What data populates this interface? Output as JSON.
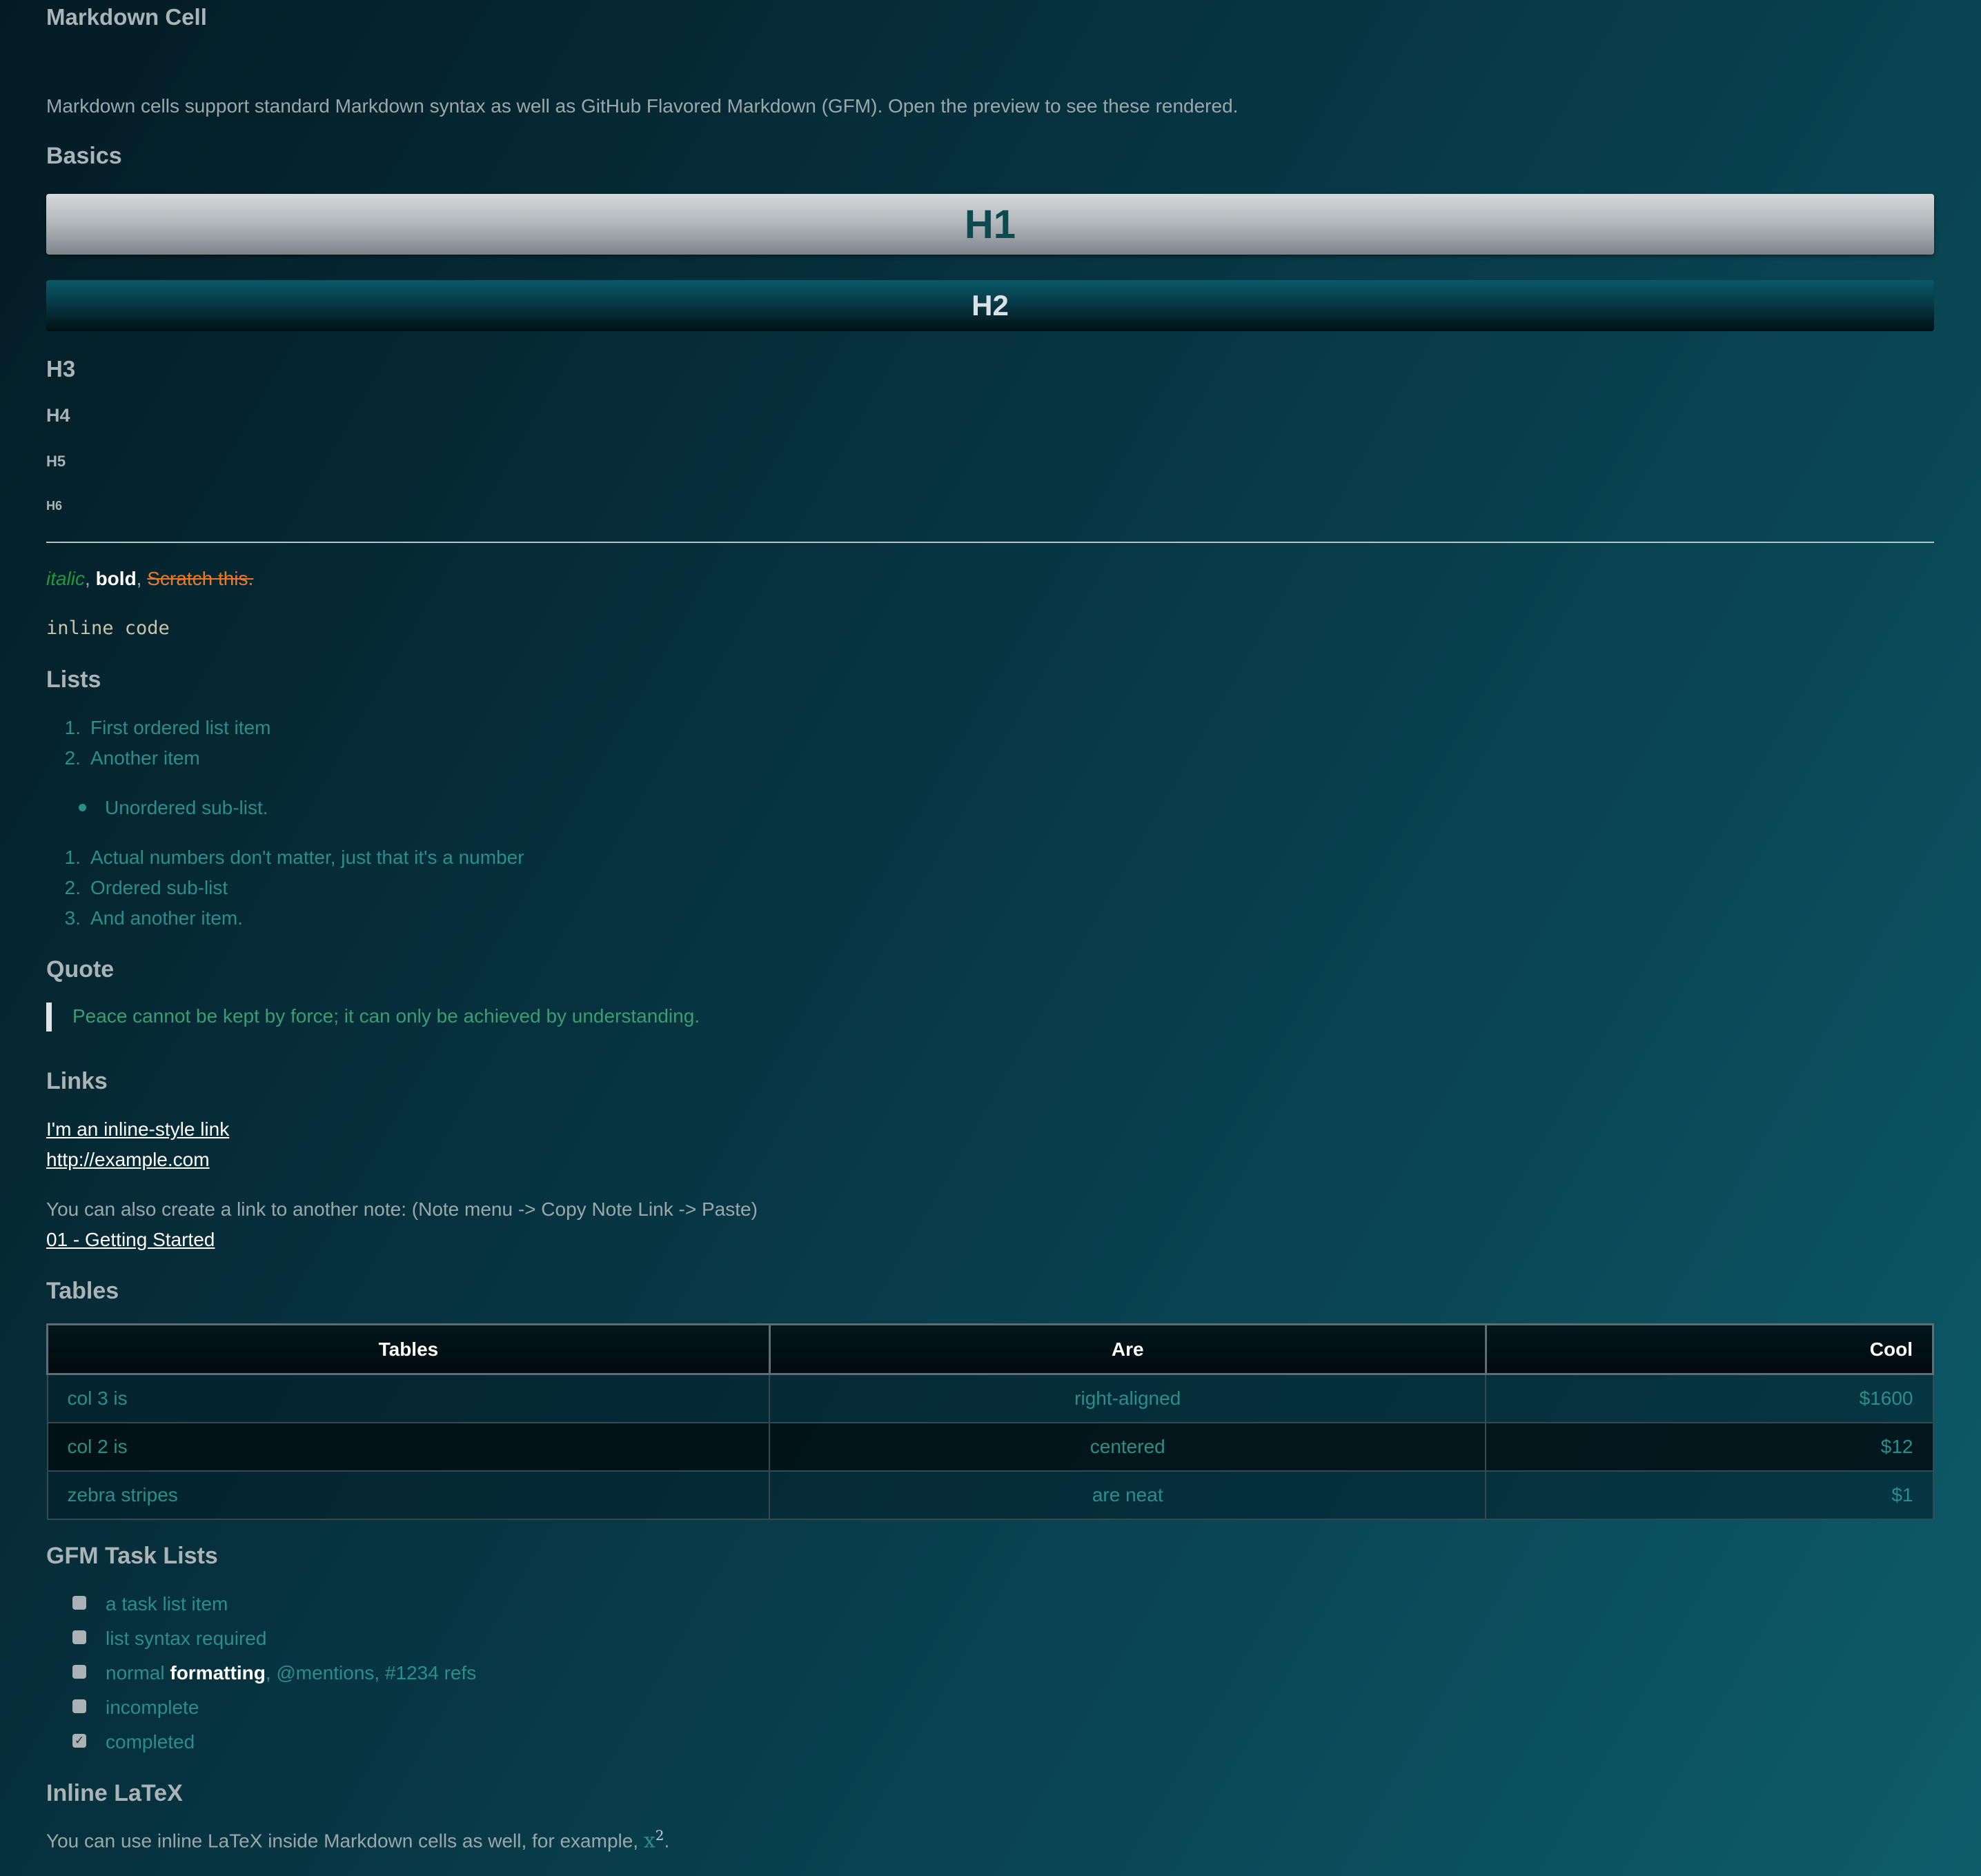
{
  "cell": {
    "title": "Markdown Cell",
    "intro": "Markdown cells support standard Markdown syntax as well as GitHub Flavored Markdown (GFM). Open the preview to see these rendered."
  },
  "basics": {
    "heading": "Basics",
    "h1": "H1",
    "h2": "H2",
    "h3": "H3",
    "h4": "H4",
    "h5": "H5",
    "h6": "H6",
    "italic": "italic",
    "bold": "bold",
    "strike": "Scratch this.",
    "inline_code": "inline code"
  },
  "lists": {
    "heading": "Lists",
    "ordered": [
      {
        "num": "1.",
        "text": "First ordered list item"
      },
      {
        "num": "2.",
        "text": "Another item"
      }
    ],
    "unordered": [
      "Unordered sub-list."
    ],
    "ordered2": [
      {
        "num": "1.",
        "text": "Actual numbers don't matter, just that it's a number"
      },
      {
        "num": "2.",
        "text": "Ordered sub-list"
      },
      {
        "num": "3.",
        "text": "And another item."
      }
    ]
  },
  "quote": {
    "heading": "Quote",
    "text": "Peace cannot be kept by force; it can only be achieved by understanding."
  },
  "links": {
    "heading": "Links",
    "inline_link": "I'm an inline-style link",
    "url_link": "http://example.com",
    "note_text": "You can also create a link to another note: (Note menu -> Copy Note Link -> Paste)",
    "note_link": "01 - Getting Started"
  },
  "tables": {
    "heading": "Tables",
    "columns": [
      "Tables",
      "Are",
      "Cool"
    ],
    "rows": [
      [
        "col 3 is",
        "right-aligned",
        "$1600"
      ],
      [
        "col 2 is",
        "centered",
        "$12"
      ],
      [
        "zebra stripes",
        "are neat",
        "$1"
      ]
    ]
  },
  "tasks": {
    "heading": "GFM Task Lists",
    "items": [
      {
        "text": "a task list item",
        "checked": false
      },
      {
        "text": "list syntax required",
        "checked": false
      },
      {
        "text_normal": "normal",
        "text_bold": "formatting",
        "text_rest": ", @mentions, #1234 refs",
        "checked": false
      },
      {
        "text": "incomplete",
        "checked": false
      },
      {
        "text": "completed",
        "checked": true
      }
    ]
  },
  "latex": {
    "heading": "Inline LaTeX",
    "text": "You can use inline LaTeX inside Markdown cells as well, for example,",
    "base": "x",
    "exponent": "2",
    "trailing": "."
  },
  "colors": {
    "italic": "#1f9a3a",
    "strike": "#e8782c",
    "list_text": "#2a8e8a",
    "quote_text": "#3a9d73"
  }
}
